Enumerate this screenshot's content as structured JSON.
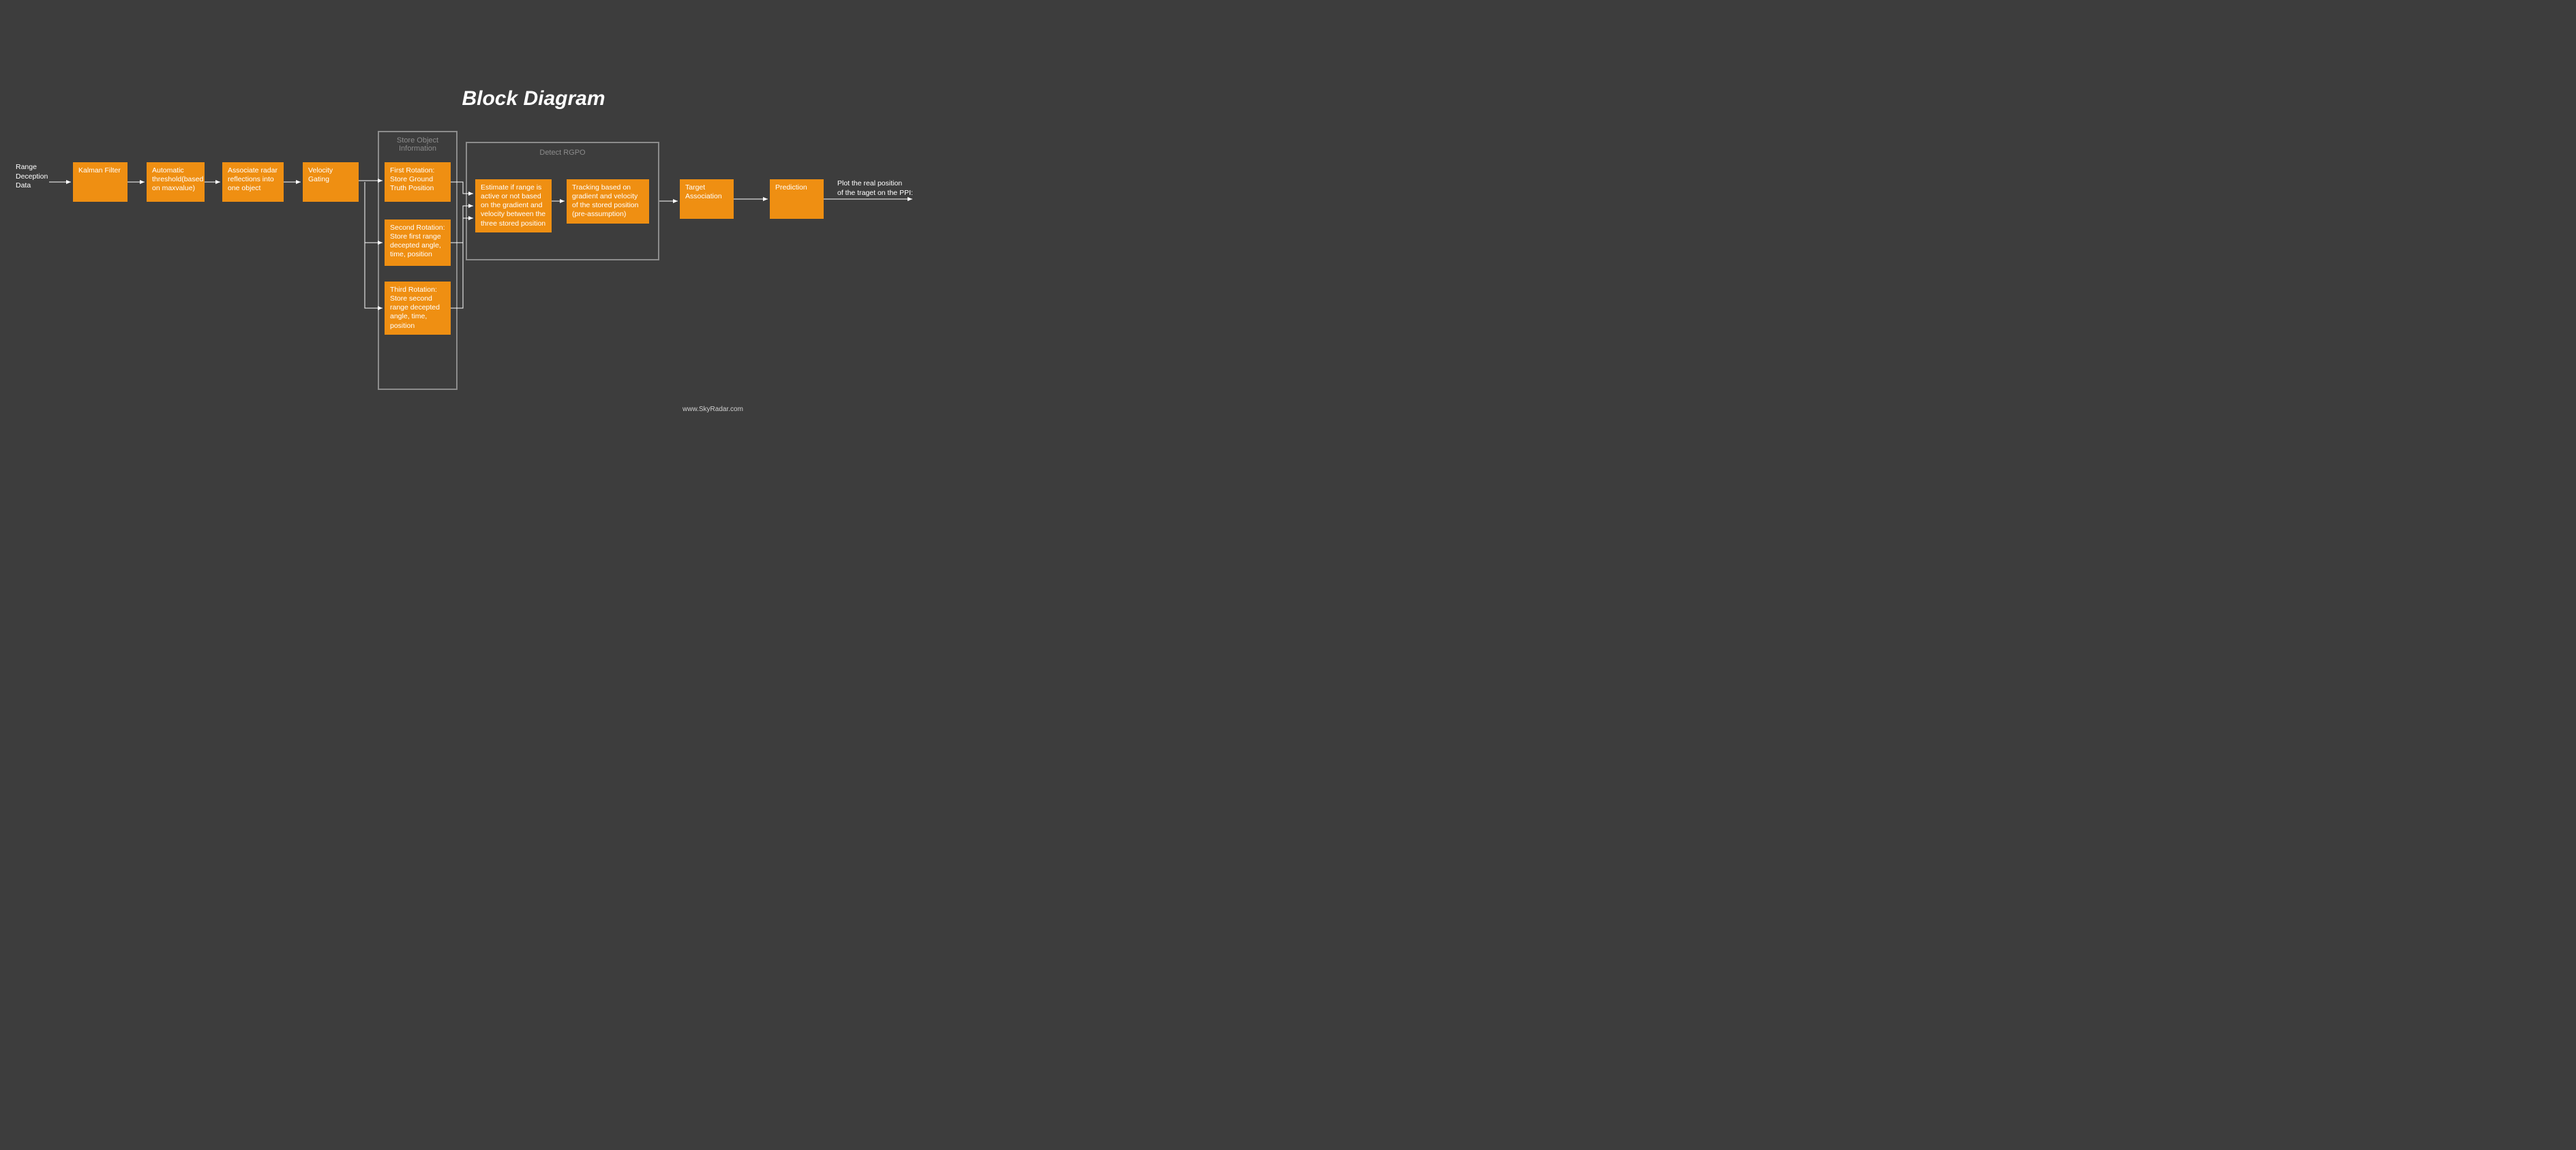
{
  "title": "Block Diagram",
  "input_label": "Range\nDeception\nData",
  "output_label": "Plot the real position\nof the traget on the PPI:",
  "blocks": {
    "b1": "Kalman Filter",
    "b2": "Automatic\nthreshold(based\non maxvalue)",
    "b3": "Associate radar\nreflections into\none object",
    "b4": "Velocity\nGating",
    "r1": "First Rotation:\nStore Ground\nTruth Position",
    "r2": "Second Rotation:\nStore first range\ndecepted angle,\ntime, position",
    "r3": "Third Rotation:\nStore second\nrange decepted\nangle, time,\nposition",
    "d1": "Estimate if range is\nactive or not based\non the gradient and\nvelocity between the\nthree stored position",
    "d2": "Tracking based on\ngradient and velocity\nof the stored position\n(pre-assumption)",
    "b5": "Target\nAssociation",
    "b6": "Prediction"
  },
  "groups": {
    "store": "Store Object\nInformation",
    "detect": "Detect RGPO"
  },
  "footer": "www.SkyRadar.com"
}
